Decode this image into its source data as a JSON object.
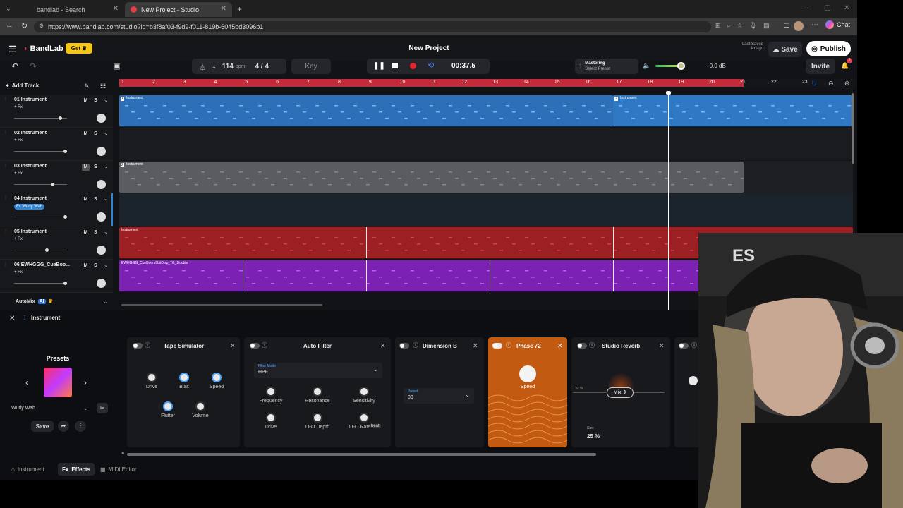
{
  "browser": {
    "tabs": [
      {
        "label": "bandlab - Search"
      },
      {
        "label": "New Project - Studio"
      }
    ],
    "url": "https://www.bandlab.com/studio?id=b3f8af03-f9d9-f011-819b-6045bd3096b1",
    "chat_label": "Chat"
  },
  "header": {
    "logo": "BandLab",
    "get_label": "Get",
    "project_title": "New Project",
    "last_saved_label": "Last Saved",
    "last_saved_time": "4h ago",
    "save_label": "Save",
    "publish_label": "Publish"
  },
  "toolbar": {
    "bpm_value": "114",
    "bpm_unit": "bpm",
    "time_sig": "4 / 4",
    "key_label": "Key",
    "time_display": "00:37.5",
    "mastering_label": "Mastering",
    "mastering_preset": "Select Preset",
    "volume_db": "+0.0 dB",
    "invite_label": "Invite",
    "notif_count": "2",
    "add_track_label": "Add Track"
  },
  "ruler": {
    "bars": [
      "1",
      "2",
      "3",
      "4",
      "5",
      "6",
      "7",
      "8",
      "9",
      "10",
      "11",
      "12",
      "13",
      "14",
      "15",
      "16",
      "17",
      "18",
      "19",
      "20",
      "21",
      "22",
      "23"
    ]
  },
  "tracks": [
    {
      "name": "01 Instrument",
      "fx": "+ Fx",
      "color": "#2d6fb5",
      "mute": "M",
      "solo": "S"
    },
    {
      "name": "02 Instrument",
      "fx": "+ Fx",
      "color": "#1e1f23",
      "mute": "M",
      "solo": "S"
    },
    {
      "name": "03 Instrument",
      "fx": "+ Fx",
      "color": "#5a5b5f",
      "mute": "M",
      "solo": "S"
    },
    {
      "name": "04 Instrument",
      "fx": "Fx Wurly Wah",
      "color": "#1a222b",
      "mute": "M",
      "solo": "S"
    },
    {
      "name": "05 Instrument",
      "fx": "+ Fx",
      "color": "#9a1e22",
      "mute": "M",
      "solo": "S"
    },
    {
      "name": "06 EWHGGG_CueBoo...",
      "fx": "+ Fx",
      "color": "#7a1fb0",
      "mute": "M",
      "solo": "S"
    }
  ],
  "clips": {
    "c1": "Instrument",
    "c2": "Instrument",
    "c3": "Instrument",
    "c5": "Instrument",
    "c6": "EWHGGG_CueBoom8bitDisp_Tilt_Double",
    "n1": "1",
    "n2": "2",
    "n3": "2"
  },
  "automix": {
    "label": "AutoMix",
    "badge": "AI"
  },
  "fx_panel": {
    "track_label": "Instrument",
    "presets_title": "Presets",
    "preset_name": "Wurly Wah",
    "save_label": "Save",
    "tape": {
      "title": "Tape Simulator",
      "knobs": [
        "Drive",
        "Bias",
        "Speed",
        "Flutter",
        "Volume"
      ]
    },
    "filter": {
      "title": "Auto Filter",
      "mode_label": "Filter Mode",
      "mode_value": "HPF",
      "knobs": [
        "Frequency",
        "Resonance",
        "Sensitivity",
        "Drive",
        "LFO Depth",
        "LFO Rate"
      ],
      "beat_label": "beat"
    },
    "dimension": {
      "title": "Dimension B",
      "preset_label": "Preset",
      "preset_value": "03"
    },
    "phase": {
      "title": "Phase 72",
      "knob_label": "Speed"
    },
    "reverb": {
      "title": "Studio Reverb",
      "mix_label": "Mix",
      "mix_pct": "32 %",
      "size_label": "Size",
      "size_value": "25 %"
    }
  },
  "bottom_tabs": [
    "Instrument",
    "Effects",
    "MIDI Editor"
  ]
}
